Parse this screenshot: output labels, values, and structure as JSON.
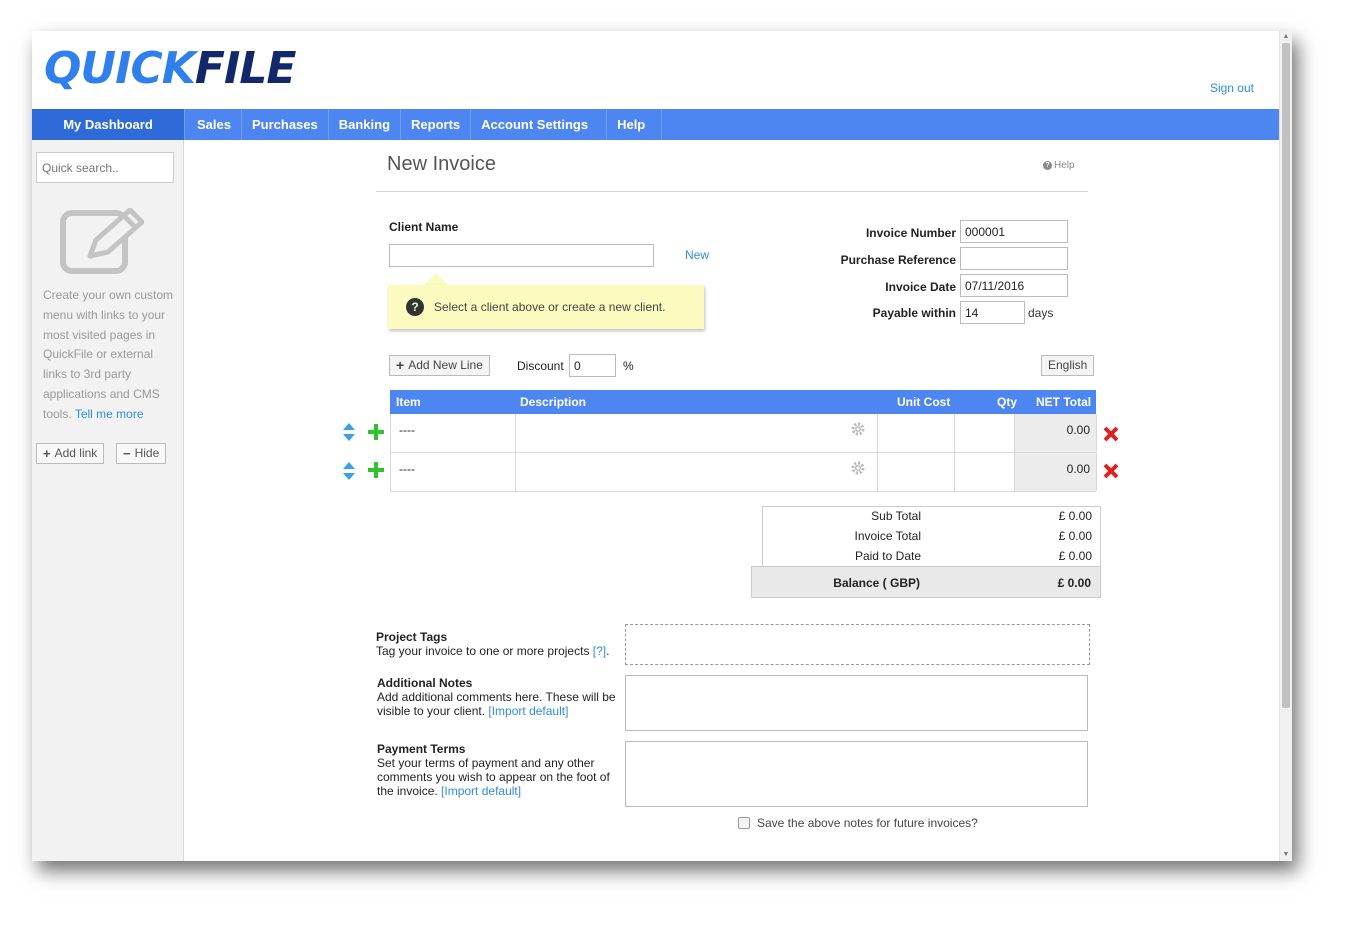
{
  "header": {
    "logo_part1": "QUICK",
    "logo_part2": "FILE",
    "sign_out": "Sign out"
  },
  "nav": {
    "dashboard": "My Dashboard",
    "items": [
      "Sales",
      "Purchases",
      "Banking",
      "Reports",
      "Account Settings",
      "Help"
    ]
  },
  "sidebar": {
    "search_placeholder": "Quick search..",
    "description": "Create your own custom menu with links to your most visited pages in QuickFile or external links to 3rd party applications and CMS tools.",
    "tell_me_more": "Tell me more",
    "add_link": "Add link",
    "hide": "Hide"
  },
  "page": {
    "title": "New Invoice",
    "help": "Help"
  },
  "client": {
    "label": "Client Name",
    "value": "",
    "new_link": "New",
    "tooltip": "Select a client above or create a new client."
  },
  "invoice": {
    "number_label": "Invoice Number",
    "number_value": "000001",
    "purchase_ref_label": "Purchase Reference",
    "purchase_ref_value": "",
    "date_label": "Invoice Date",
    "date_value": "07/11/2016",
    "payable_label": "Payable within",
    "payable_value": "14",
    "payable_unit": "days"
  },
  "toolbar": {
    "add_line": "Add New Line",
    "discount_label": "Discount",
    "discount_value": "0",
    "discount_unit": "%",
    "language": "English"
  },
  "table": {
    "headers": [
      "Item",
      "Description",
      "Unit Cost",
      "Qty",
      "NET Total"
    ],
    "rows": [
      {
        "item": "----",
        "description": "",
        "unit_cost": "",
        "qty": "",
        "net_total": "0.00"
      },
      {
        "item": "----",
        "description": "",
        "unit_cost": "",
        "qty": "",
        "net_total": "0.00"
      }
    ]
  },
  "totals": {
    "sub_total_label": "Sub Total",
    "sub_total": "£ 0.00",
    "invoice_total_label": "Invoice Total",
    "invoice_total": "£ 0.00",
    "paid_label": "Paid to Date",
    "paid": "£ 0.00",
    "balance_label": "Balance ( GBP)",
    "balance": "£ 0.00"
  },
  "notes": {
    "project_tags_title": "Project Tags",
    "project_tags_text": "Tag your invoice to one or more projects",
    "project_tags_link": "[?]",
    "additional_title": "Additional Notes",
    "additional_text": "Add additional comments here. These will be visible to your client.",
    "additional_link": "[Import default]",
    "payment_title": "Payment Terms",
    "payment_text": "Set your terms of payment and any other comments you wish to appear on the foot of the invoice.",
    "payment_link": "[Import default]",
    "save_label": "Save the above notes for future invoices?"
  },
  "colors": {
    "nav": "#4d86f0",
    "dashboard_tab": "#2f6bd8",
    "link": "#2d8ddb",
    "tooltip_bg": "#fbfbc0",
    "delete": "#e02020",
    "add": "#2ec52e"
  }
}
